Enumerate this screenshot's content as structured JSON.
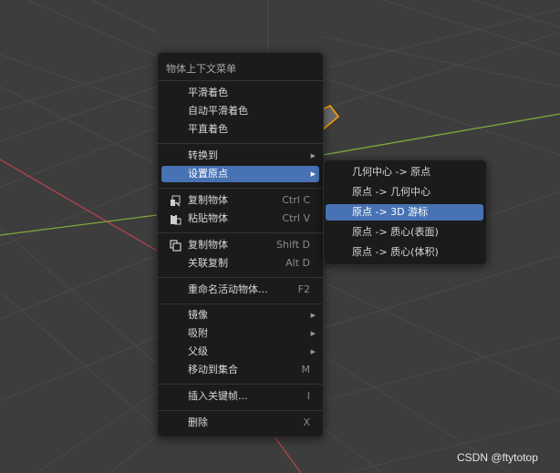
{
  "context_menu": {
    "title": "物体上下文菜单",
    "items": [
      {
        "label": "平滑着色",
        "shortcut": ""
      },
      {
        "label": "自动平滑着色",
        "shortcut": ""
      },
      {
        "label": "平直着色",
        "shortcut": ""
      },
      {
        "label": "转换到",
        "shortcut": "",
        "submenu": true
      },
      {
        "label": "设置原点",
        "shortcut": "",
        "submenu": true
      },
      {
        "label": "复制物体",
        "shortcut": "Ctrl C",
        "icon": "copy-icon"
      },
      {
        "label": "粘贴物体",
        "shortcut": "Ctrl V",
        "icon": "paste-icon"
      },
      {
        "label": "复制物体",
        "shortcut": "Shift D",
        "icon": "duplicate-icon"
      },
      {
        "label": "关联复制",
        "shortcut": "Alt D"
      },
      {
        "label": "重命名活动物体...",
        "shortcut": "F2"
      },
      {
        "label": "镜像",
        "shortcut": "",
        "submenu": true
      },
      {
        "label": "吸附",
        "shortcut": "",
        "submenu": true
      },
      {
        "label": "父级",
        "shortcut": "",
        "submenu": true
      },
      {
        "label": "移动到集合",
        "shortcut": "M"
      },
      {
        "label": "插入关键帧...",
        "shortcut": "I"
      },
      {
        "label": "删除",
        "shortcut": "X"
      }
    ]
  },
  "set_origin_submenu": {
    "items": [
      {
        "label": "几何中心 -> 原点"
      },
      {
        "label": "原点 -> 几何中心"
      },
      {
        "label": "原点 -> 3D 游标"
      },
      {
        "label": "原点 -> 质心(表面)"
      },
      {
        "label": "原点 -> 质心(体积)"
      }
    ]
  },
  "watermark": "CSDN @ftytotop",
  "colors": {
    "highlight": "#4772b3",
    "menu_bg": "#1b1b1b",
    "viewport_bg": "#3d3d3d",
    "x_axis": "#b5434d",
    "y_axis": "#7ea83a",
    "selection_outline": "#f5a000"
  }
}
